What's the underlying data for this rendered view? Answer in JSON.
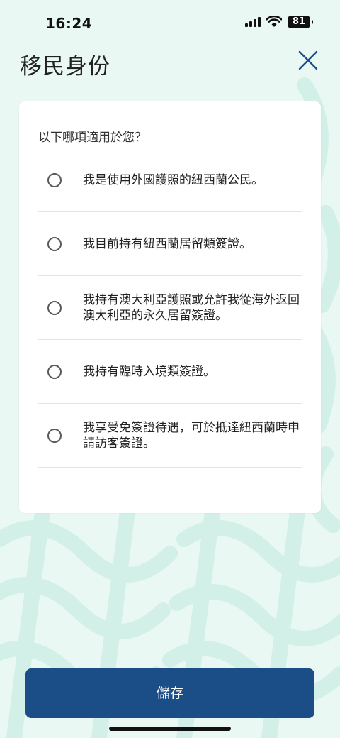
{
  "status_bar": {
    "time": "16:24",
    "battery": "81",
    "icons": [
      "signal-icon",
      "wifi-icon",
      "battery-icon"
    ]
  },
  "header": {
    "title": "移民身份",
    "close_icon": "close-icon"
  },
  "form": {
    "question": "以下哪項適用於您？",
    "options": [
      {
        "label": "我是使用外國護照的紐西蘭公民。",
        "selected": false
      },
      {
        "label": "我目前持有紐西蘭居留類簽證。",
        "selected": false
      },
      {
        "label": "我持有澳大利亞護照或允許我從海外返回澳大利亞的永久居留簽證。",
        "selected": false
      },
      {
        "label": "我持有臨時入境類簽證。",
        "selected": false
      },
      {
        "label": "我享受免簽證待遇，可於抵達紐西蘭時申請訪客簽證。",
        "selected": false
      }
    ]
  },
  "footer": {
    "save_label": "儲存"
  },
  "colors": {
    "background": "#eaf8f4",
    "pattern": "#d2f0e8",
    "primary_button": "#1b4d86",
    "close_icon": "#1b4d86"
  }
}
